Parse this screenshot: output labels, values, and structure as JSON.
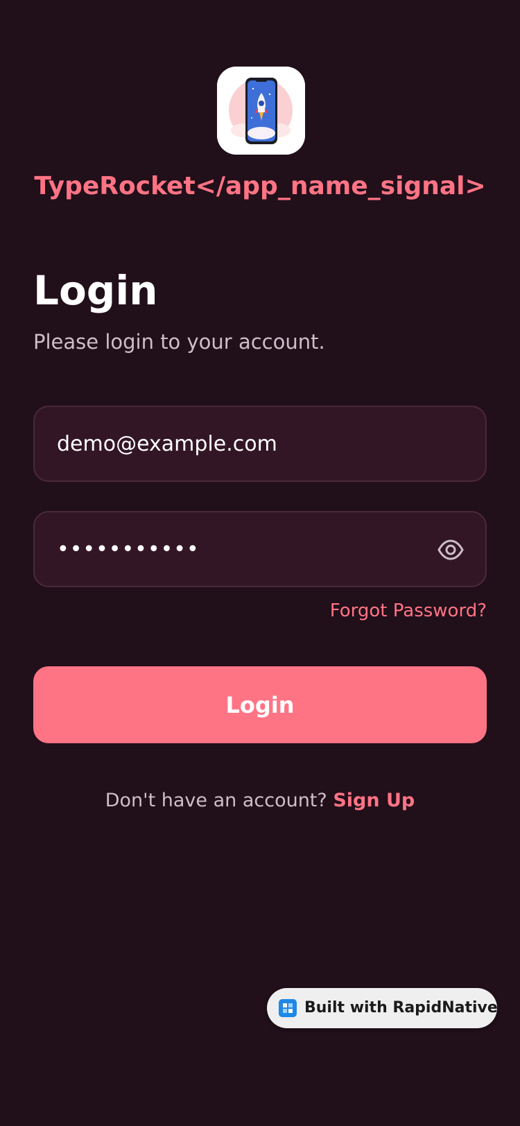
{
  "app": {
    "name": "TypeRocket</app_name_signal>"
  },
  "login": {
    "title": "Login",
    "subtitle": "Please login to your account.",
    "email_value": "demo@example.com",
    "password_value": "•••••••••••",
    "forgot_label": "Forgot Password?",
    "button_label": "Login",
    "signup_prompt": "Don't have an account?",
    "signup_label": "Sign Up"
  },
  "badge": {
    "label": "Built with RapidNative"
  },
  "icons": {
    "app": "rocket-phone-icon",
    "password_toggle": "eye-icon",
    "badge": "rapidnative-logo-icon"
  },
  "colors": {
    "background": "#210f1a",
    "accent": "#ff7485",
    "field_background": "#331625",
    "field_border": "#4b2a3a"
  }
}
